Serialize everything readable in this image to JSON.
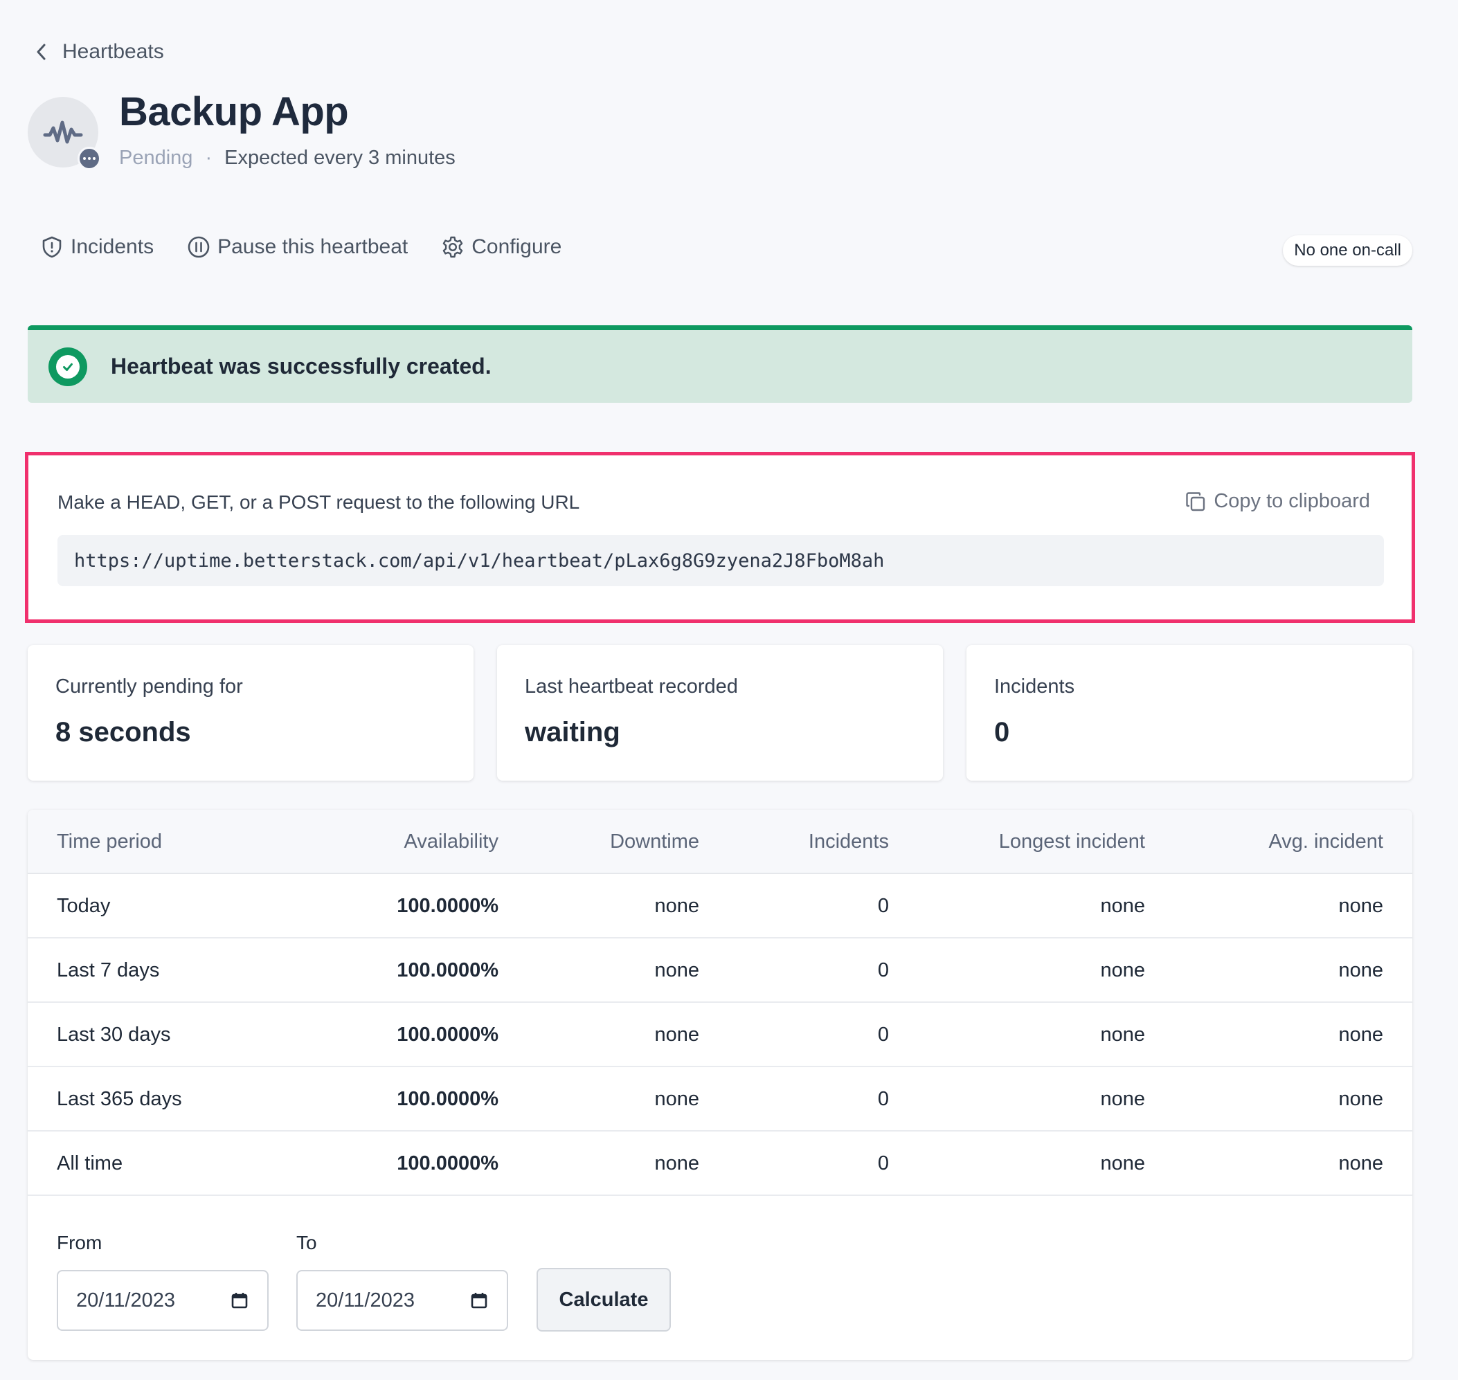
{
  "breadcrumb": {
    "label": "Heartbeats",
    "icon": "chevron-left-icon"
  },
  "header": {
    "title": "Backup App",
    "status": "Pending",
    "separator": "·",
    "frequency": "Expected every 3 minutes",
    "avatar_icon": "activity-icon",
    "badge_icon": "more-icon"
  },
  "actions": [
    {
      "label": "Incidents",
      "icon": "shield-icon"
    },
    {
      "label": "Pause this heartbeat",
      "icon": "pause-icon"
    },
    {
      "label": "Configure",
      "icon": "gear-icon"
    }
  ],
  "oncall": {
    "label": "No one on-call"
  },
  "banner": {
    "message": "Heartbeat was successfully created.",
    "icon": "check-circle-icon",
    "color": "#0e9960",
    "background": "#d4e8df"
  },
  "url_card": {
    "label": "Make a HEAD, GET, or a POST request to the following URL",
    "copy_label": "Copy to clipboard",
    "copy_icon": "copy-icon",
    "url": "https://uptime.betterstack.com/api/v1/heartbeat/pLax6g8G9zyena2J8FboM8ah",
    "highlight_color": "#f0306d"
  },
  "stats": [
    {
      "label": "Currently pending for",
      "value": "8 seconds"
    },
    {
      "label": "Last heartbeat recorded",
      "value": "waiting"
    },
    {
      "label": "Incidents",
      "value": "0"
    }
  ],
  "availability": {
    "columns": [
      "Time period",
      "Availability",
      "Downtime",
      "Incidents",
      "Longest incident",
      "Avg. incident"
    ],
    "rows": [
      [
        "Today",
        "100.0000%",
        "none",
        "0",
        "none",
        "none"
      ],
      [
        "Last 7 days",
        "100.0000%",
        "none",
        "0",
        "none",
        "none"
      ],
      [
        "Last 30 days",
        "100.0000%",
        "none",
        "0",
        "none",
        "none"
      ],
      [
        "Last 365 days",
        "100.0000%",
        "none",
        "0",
        "none",
        "none"
      ],
      [
        "All time",
        "100.0000%",
        "none",
        "0",
        "none",
        "none"
      ]
    ]
  },
  "range": {
    "from_label": "From",
    "from_value": "20/11/2023",
    "to_label": "To",
    "to_value": "20/11/2023",
    "calendar_icon": "calendar-icon",
    "calculate_label": "Calculate"
  }
}
